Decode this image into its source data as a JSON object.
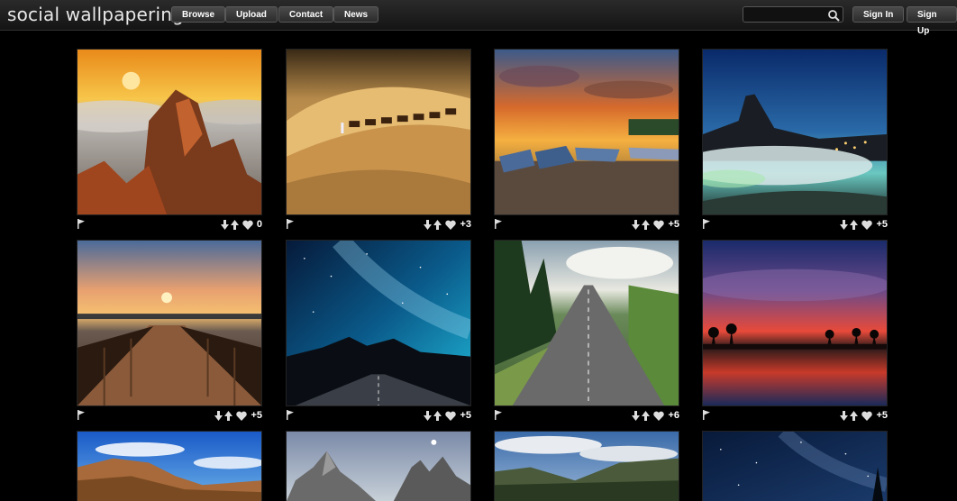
{
  "site": {
    "logo": "social wallpapering"
  },
  "nav": [
    {
      "label": "Browse"
    },
    {
      "label": "Upload"
    },
    {
      "label": "Contact"
    },
    {
      "label": "News"
    }
  ],
  "search": {
    "value": "",
    "placeholder": ""
  },
  "auth": {
    "sign_in": "Sign In",
    "sign_up": "Sign Up"
  },
  "icons": {
    "search": "search-icon",
    "flag": "flag-icon",
    "down": "arrow-down-icon",
    "up": "arrow-up-icon",
    "heart": "heart-icon"
  },
  "wallpapers": [
    {
      "subject": "sunset-rocks-clouds",
      "score": "0"
    },
    {
      "subject": "desert-camel-caravan",
      "score": "+3"
    },
    {
      "subject": "boats-sunset-shore",
      "score": "+5"
    },
    {
      "subject": "mountain-fog-city-night",
      "score": "+5"
    },
    {
      "subject": "pier-sunset",
      "score": "+5"
    },
    {
      "subject": "milky-way-road",
      "score": "+5"
    },
    {
      "subject": "forest-road",
      "score": "+6"
    },
    {
      "subject": "palm-lake-sunset",
      "score": "+5"
    },
    {
      "subject": "canyon-blue-sky",
      "score": ""
    },
    {
      "subject": "dolomites-peaks",
      "score": ""
    },
    {
      "subject": "valley-clouds",
      "score": ""
    },
    {
      "subject": "night-sky-stars",
      "score": ""
    }
  ]
}
